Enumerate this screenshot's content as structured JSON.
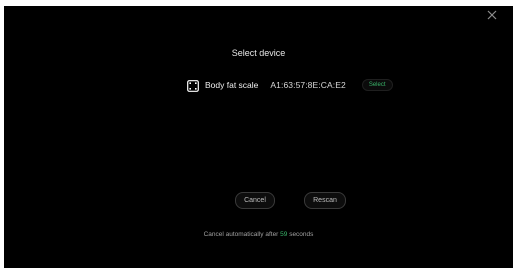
{
  "dialog": {
    "title": "Select device",
    "device": {
      "name": "Body fat scale",
      "mac": "A1:63:57:8E:CA:E2",
      "select_label": "Select",
      "icon": "scale-icon"
    },
    "buttons": {
      "cancel_label": "Cancel",
      "rescan_label": "Rescan"
    },
    "countdown": {
      "prefix": "Cancel automatically after ",
      "seconds": "59",
      "suffix": " seconds"
    },
    "close_icon": "close-icon",
    "colors": {
      "background": "#000000",
      "accent": "#39b56a",
      "text": "#e6e6e6"
    }
  }
}
